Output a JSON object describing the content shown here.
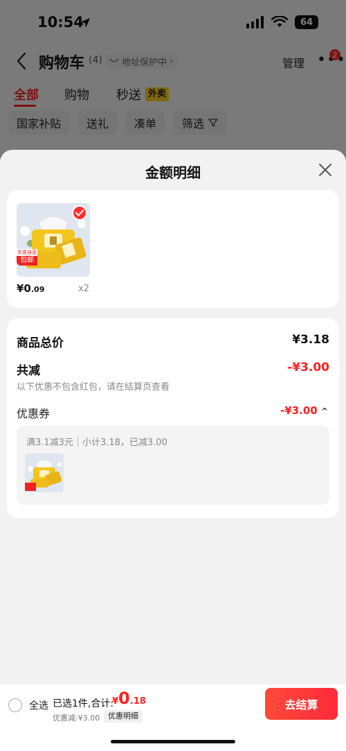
{
  "status_bar": {
    "time": "10:54",
    "battery": "64"
  },
  "nav": {
    "title": "购物车",
    "count": "(4)",
    "protect_label": "地址保护中",
    "manage_label": "管理",
    "more_badge": "2"
  },
  "tabs": [
    {
      "label": "全部",
      "active": true
    },
    {
      "label": "购物",
      "active": false
    },
    {
      "label": "秒送",
      "active": false
    }
  ],
  "tab_tag": "外卖",
  "chips": [
    "国家补贴",
    "送礼",
    "凑单",
    "筛选"
  ],
  "sheet": {
    "title": "金额明细",
    "goods": {
      "price_int": "¥0",
      "price_dec": ".09",
      "quantity": "x2",
      "free_tag_top": "京喜自营",
      "free_tag_bottom": "包邮"
    },
    "summary": {
      "total_label": "商品总价",
      "total_value": "¥3.18",
      "reduce_label": "共减",
      "reduce_value": "-¥3.00",
      "note": "以下优惠不包含红包，请在结算页查看",
      "coupon_label": "优惠券",
      "coupon_value": "-¥3.00",
      "coupon_desc": "满3.1减3元｜小计3.18，已减3.00"
    }
  },
  "bottom_bar": {
    "select_all": "全选",
    "selected_text": "已选1件,合计:",
    "total_currency": "¥",
    "total_int": "0",
    "total_dec": ".18",
    "discount_text": "优惠减:¥3.00",
    "detail_button": "优惠明细",
    "checkout_button": "去结算"
  },
  "colors": {
    "accent": "#ff2020",
    "tag_yellow": "#ffd21f"
  }
}
